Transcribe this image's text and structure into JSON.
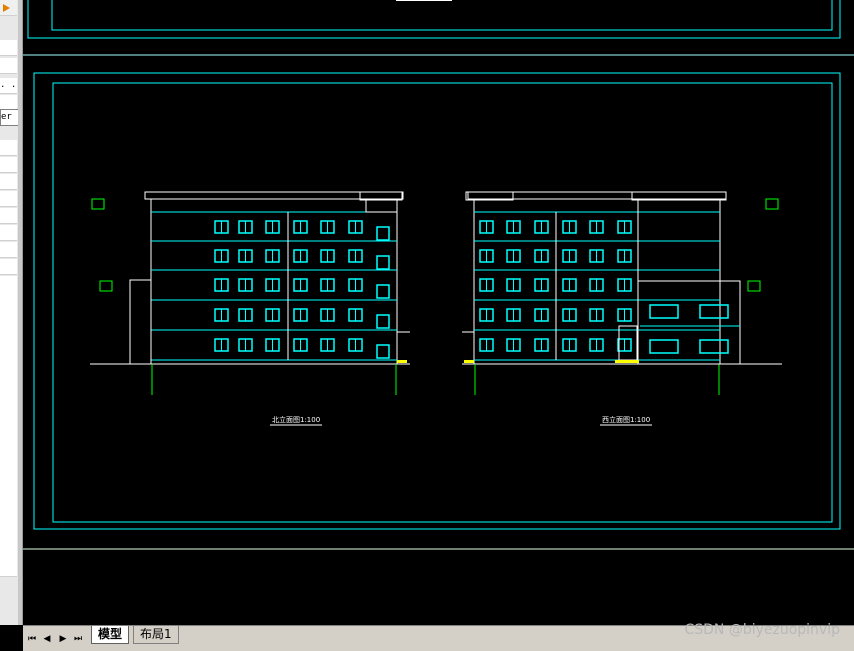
{
  "panel": {
    "row_text_1": ". .",
    "row_text_2": "er"
  },
  "drawing": {
    "caption_left": "北立面图1:100",
    "caption_right": "西立面图1:100",
    "colors": {
      "frame": "#00ffff",
      "lines": "#ffffff",
      "dims": "#00ff00",
      "ground": "#ffff00"
    }
  },
  "tabs": {
    "model": "模型",
    "layout1": "布局1"
  },
  "nav_icons": [
    "first-icon",
    "prev-icon",
    "next-icon",
    "last-icon"
  ],
  "watermark": "CSDN @biyezuopinvip"
}
